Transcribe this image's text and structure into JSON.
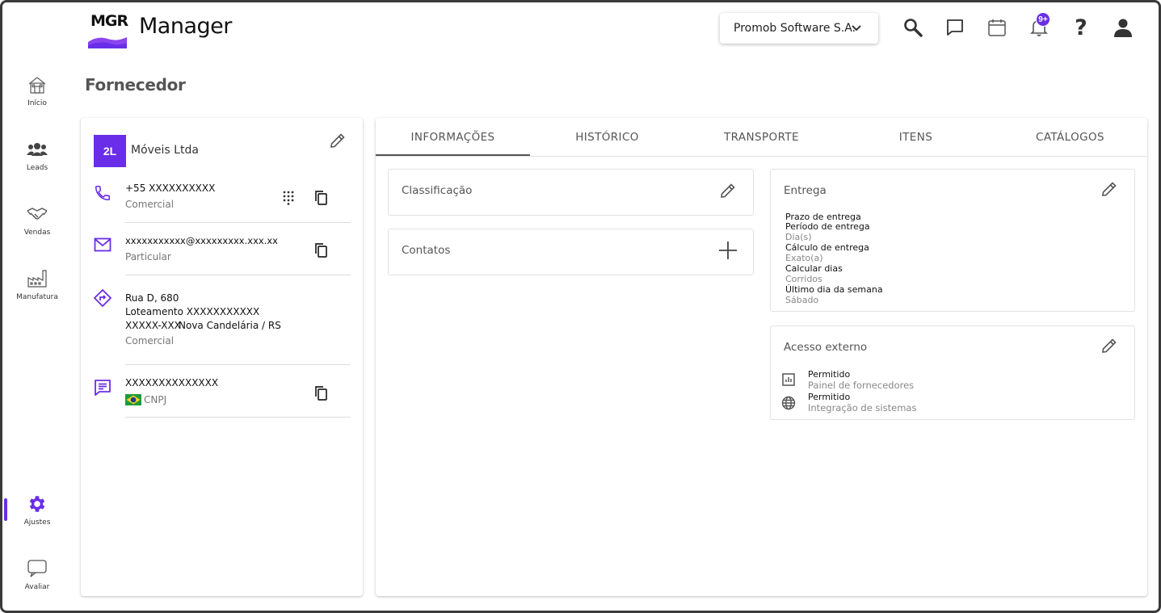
{
  "app": {
    "logo_text": "MGR",
    "title": "Manager",
    "accent": "#6a2ee8"
  },
  "sidebar": {
    "items": [
      {
        "label": "Início",
        "icon": "home-icon"
      },
      {
        "label": "Leads",
        "icon": "people-icon"
      },
      {
        "label": "Vendas",
        "icon": "handshake-icon"
      },
      {
        "label": "Manufatura",
        "icon": "factory-icon"
      },
      {
        "label": "Ajustes",
        "icon": "gear-icon",
        "active": true
      },
      {
        "label": "Avaliar",
        "icon": "chat-bubble-icon"
      }
    ]
  },
  "header": {
    "company_selector": "Promob Software S.A.",
    "notifications_badge": "9+"
  },
  "page": {
    "title": "Fornecedor"
  },
  "profile": {
    "avatar": "2L",
    "name": "Móveis Ltda",
    "phone": {
      "value": "+55 XXXXXXXXXX",
      "type": "Comercial"
    },
    "email": {
      "value": "xxxxxxxxxxx@xxxxxxxxx.xxx.xx",
      "type": "Particular"
    },
    "address": {
      "line1": "Rua D, 680",
      "line2": "Loteamento  XXXXXXXXXXX",
      "line3": "XXXXX-XXX",
      "line3b": "Nova Candelária / RS",
      "type": "Comercial"
    },
    "document": {
      "value": "XXXXXXXXXXXXXX",
      "type": "CNPJ"
    }
  },
  "tabs": [
    {
      "label": "INFORMAÇÕES",
      "active": true
    },
    {
      "label": "HISTÓRICO"
    },
    {
      "label": "TRANSPORTE"
    },
    {
      "label": "ITENS"
    },
    {
      "label": "CATÁLOGOS"
    }
  ],
  "sections": {
    "classificacao": {
      "title": "Classificação"
    },
    "contatos": {
      "title": "Contatos"
    },
    "entrega": {
      "title": "Entrega",
      "fields": [
        {
          "label": "Prazo de entrega"
        },
        {
          "label": "Período de entrega",
          "value": "Dia(s)"
        },
        {
          "label": "Cálculo de entrega",
          "value": "Exato(a)"
        },
        {
          "label": "Calcular dias",
          "value": "Corridos"
        },
        {
          "label": "Último dia da semana",
          "value": "Sábado"
        }
      ]
    },
    "acesso_externo": {
      "title": "Acesso externo",
      "items": [
        {
          "label": "Permitido",
          "value": "Painel de fornecedores",
          "icon": "bar-chart-icon"
        },
        {
          "label": "Permitido",
          "value": "Integração de sistemas",
          "icon": "globe-icon"
        }
      ]
    }
  }
}
